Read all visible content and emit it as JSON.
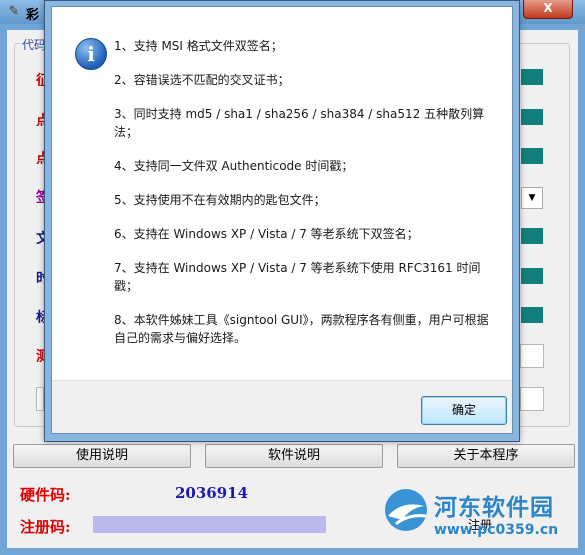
{
  "main_window": {
    "title": "彩",
    "group_label": "代码",
    "buttons": {
      "usage": "使用说明",
      "software_info": "软件说明",
      "about": "关于本程序"
    },
    "hardware_code_label": "硬件码:",
    "hardware_code_value": "2036914",
    "register_code_label": "注册码:",
    "register_code_value": "",
    "register_button": "注册",
    "close_glyph": "X",
    "left_edge_glyphs": [
      "征",
      "点",
      "点",
      "签",
      "文",
      "时",
      "标",
      "测"
    ],
    "left_edge_colors": [
      "#cc0000",
      "#cc0000",
      "#cc0000",
      "#990099",
      "#1a1a8a",
      "#1a1a8a",
      "#1a1a8a",
      "#cc0000"
    ]
  },
  "dialog": {
    "messages": [
      "1、支持 MSI 格式文件双签名；",
      "2、容错误选不匹配的交叉证书；",
      "3、同时支持 md5 / sha1 / sha256 / sha384 / sha512 五种散列算法；",
      "4、支持同一文件双 Authenticode 时间戳；",
      "5、支持使用不在有效期内的匙包文件；",
      "6、支持在 Windows XP / Vista / 7 等老系统下双签名；",
      "7、支持在 Windows XP / Vista / 7 等老系统下使用 RFC3161 时间戳；",
      "8、本软件姊妹工具《signtool GUI》，两款程序各有侧重，用户可根据自己的需求与偏好选择。"
    ],
    "ok_label": "确定"
  },
  "watermark": {
    "title": "河东软件园",
    "url": "www.pc0359.cn"
  },
  "colors": {
    "teal": "#12807a",
    "accent_blue": "#2a86c9",
    "label_red": "#e00000"
  }
}
